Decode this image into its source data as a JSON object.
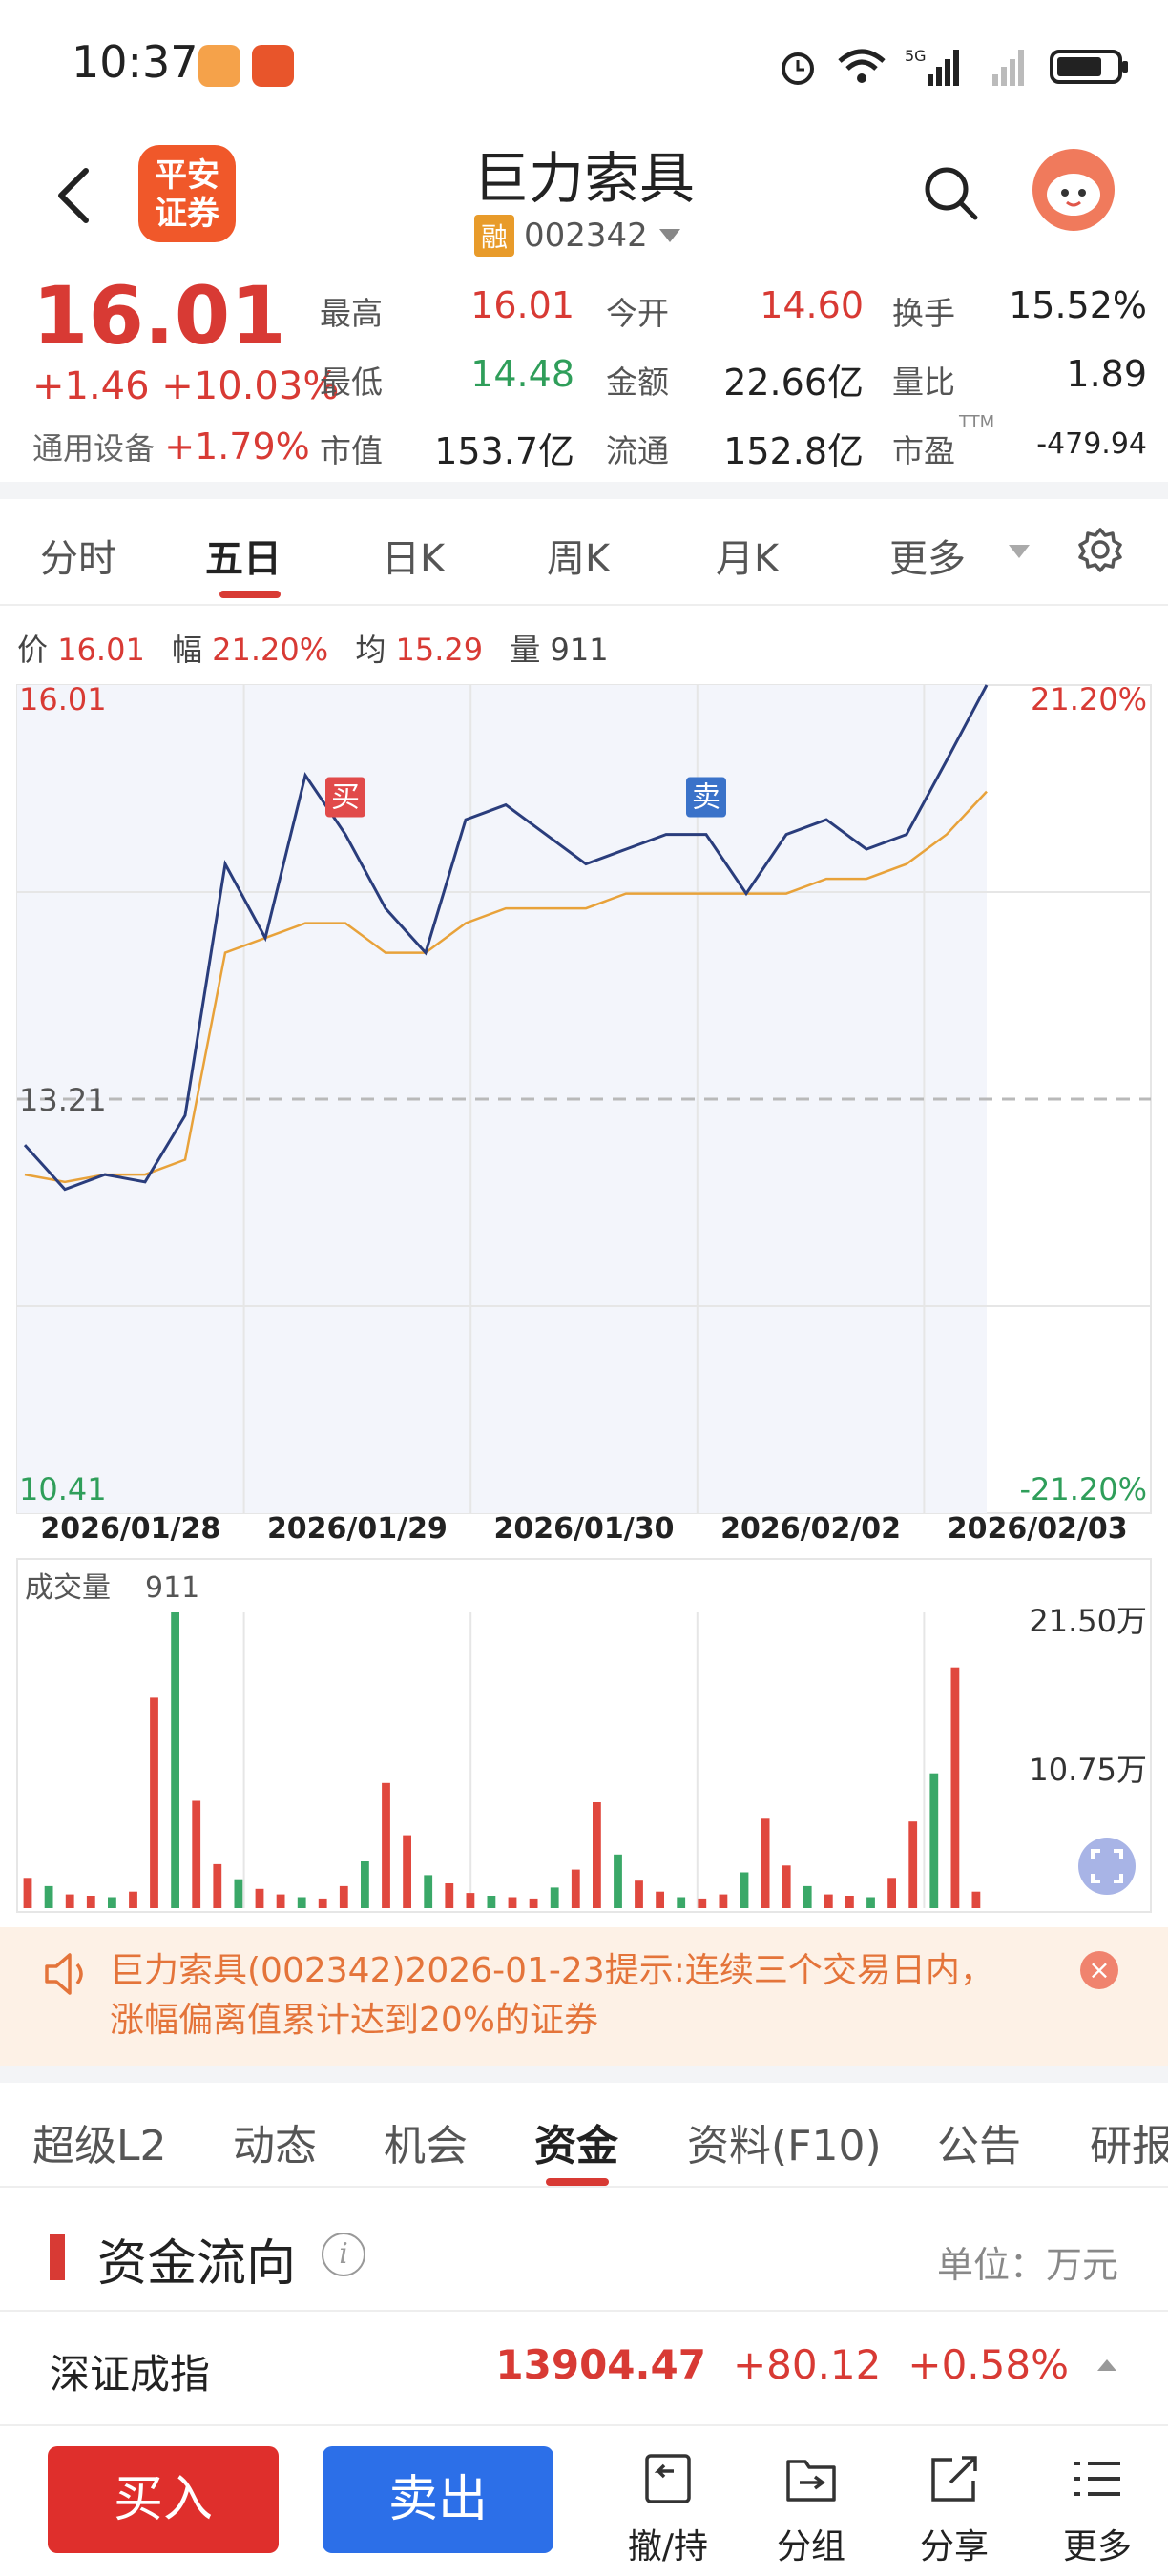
{
  "status_bar": {
    "time": "10:37"
  },
  "header": {
    "stock_name": "巨力索具",
    "margin_badge": "融",
    "stock_code": "002342"
  },
  "quote": {
    "price": "16.01",
    "change": "+1.46 +10.03%",
    "sector": "通用设备",
    "sector_change": "+1.79%",
    "cells": [
      {
        "label": "最高",
        "value": "16.01",
        "color": "red"
      },
      {
        "label": "今开",
        "value": "14.60",
        "color": "red"
      },
      {
        "label": "换手",
        "value": "15.52%",
        "color": "black"
      },
      {
        "label": "最低",
        "value": "14.48",
        "color": "green"
      },
      {
        "label": "金额",
        "value": "22.66亿",
        "color": "black"
      },
      {
        "label": "量比",
        "value": "1.89",
        "color": "black"
      },
      {
        "label": "市值",
        "value": "153.7亿",
        "color": "black"
      },
      {
        "label": "流通",
        "value": "152.8亿",
        "color": "black"
      },
      {
        "label": "市盈",
        "value": "-479.94",
        "color": "black"
      }
    ],
    "ttm_label": "TTM"
  },
  "chart_tabs": [
    "分时",
    "五日",
    "日K",
    "周K",
    "月K",
    "更多"
  ],
  "chart_info": {
    "price_label": "价",
    "price": "16.01",
    "range_label": "幅",
    "range": "21.20%",
    "avg_label": "均",
    "avg": "15.29",
    "vol_label": "量",
    "vol": "911"
  },
  "chart_data": {
    "type": "line",
    "x": [
      "2026/01/28",
      "2026/01/29",
      "2026/01/30",
      "2026/02/02",
      "2026/02/03"
    ],
    "ylim": [
      10.41,
      16.01
    ],
    "y_ticks": [
      "16.01",
      "13.21",
      "10.41"
    ],
    "y_right_ticks": [
      "21.20%",
      "-21.20%"
    ],
    "prev_close": 13.21,
    "series": [
      {
        "values": [
          12.9,
          12.6,
          12.7,
          12.65,
          13.1,
          14.8,
          14.3,
          15.4,
          15.0,
          14.5,
          14.2,
          15.1,
          15.2,
          15.0,
          14.8,
          14.9,
          15.0,
          15.0,
          14.6,
          15.0,
          15.1,
          14.9,
          15.0,
          15.5,
          16.01
        ]
      },
      {
        "values": [
          12.7,
          12.65,
          12.7,
          12.7,
          12.8,
          14.2,
          14.3,
          14.4,
          14.4,
          14.2,
          14.2,
          14.4,
          14.5,
          14.5,
          14.5,
          14.6,
          14.6,
          14.6,
          14.6,
          14.6,
          14.7,
          14.7,
          14.8,
          15.0,
          15.29
        ]
      }
    ],
    "annotations": [
      {
        "label": "买",
        "x": "2026/01/29"
      },
      {
        "label": "卖",
        "x": "2026/02/02"
      }
    ],
    "volume": {
      "label": "成交量",
      "value": "911",
      "ticks": [
        "21.50万",
        "10.75万"
      ],
      "ylim": [
        0,
        21.5
      ],
      "values": [
        2.2,
        1.6,
        1.0,
        0.9,
        0.8,
        1.2,
        15.3,
        21.5,
        7.8,
        3.2,
        2.1,
        1.4,
        1.0,
        0.8,
        0.7,
        1.6,
        3.4,
        9.1,
        5.3,
        2.4,
        1.8,
        1.1,
        0.9,
        0.8,
        0.7,
        1.5,
        2.8,
        7.7,
        3.9,
        2.0,
        1.2,
        0.8,
        0.7,
        1.0,
        2.6,
        6.5,
        3.1,
        1.6,
        1.0,
        0.9,
        0.8,
        2.2,
        6.3,
        9.8,
        17.5,
        1.2
      ]
    }
  },
  "alert": {
    "text": "巨力索具(002342)2026-01-23提示:连续三个交易日内，涨幅偏离值累计达到20%的证券",
    "close": "×"
  },
  "info_tabs": [
    "超级L2",
    "动态",
    "机会",
    "资金",
    "资料(F10)",
    "公告",
    "研报"
  ],
  "fund_flow": {
    "title": "资金流向",
    "info": "i",
    "unit": "单位：万元"
  },
  "index_row": {
    "name": "深证成指",
    "value": "13904.47",
    "change": "+80.12",
    "pct": "+0.58%"
  },
  "bottom_bar": {
    "buy": "买入",
    "sell": "卖出",
    "items": [
      {
        "label": "撤/持",
        "icon": "cancel-hold-icon"
      },
      {
        "label": "分组",
        "icon": "group-icon"
      },
      {
        "label": "分享",
        "icon": "share-icon"
      },
      {
        "label": "更多",
        "icon": "more-list-icon"
      }
    ]
  },
  "logo_text": "平安证券"
}
